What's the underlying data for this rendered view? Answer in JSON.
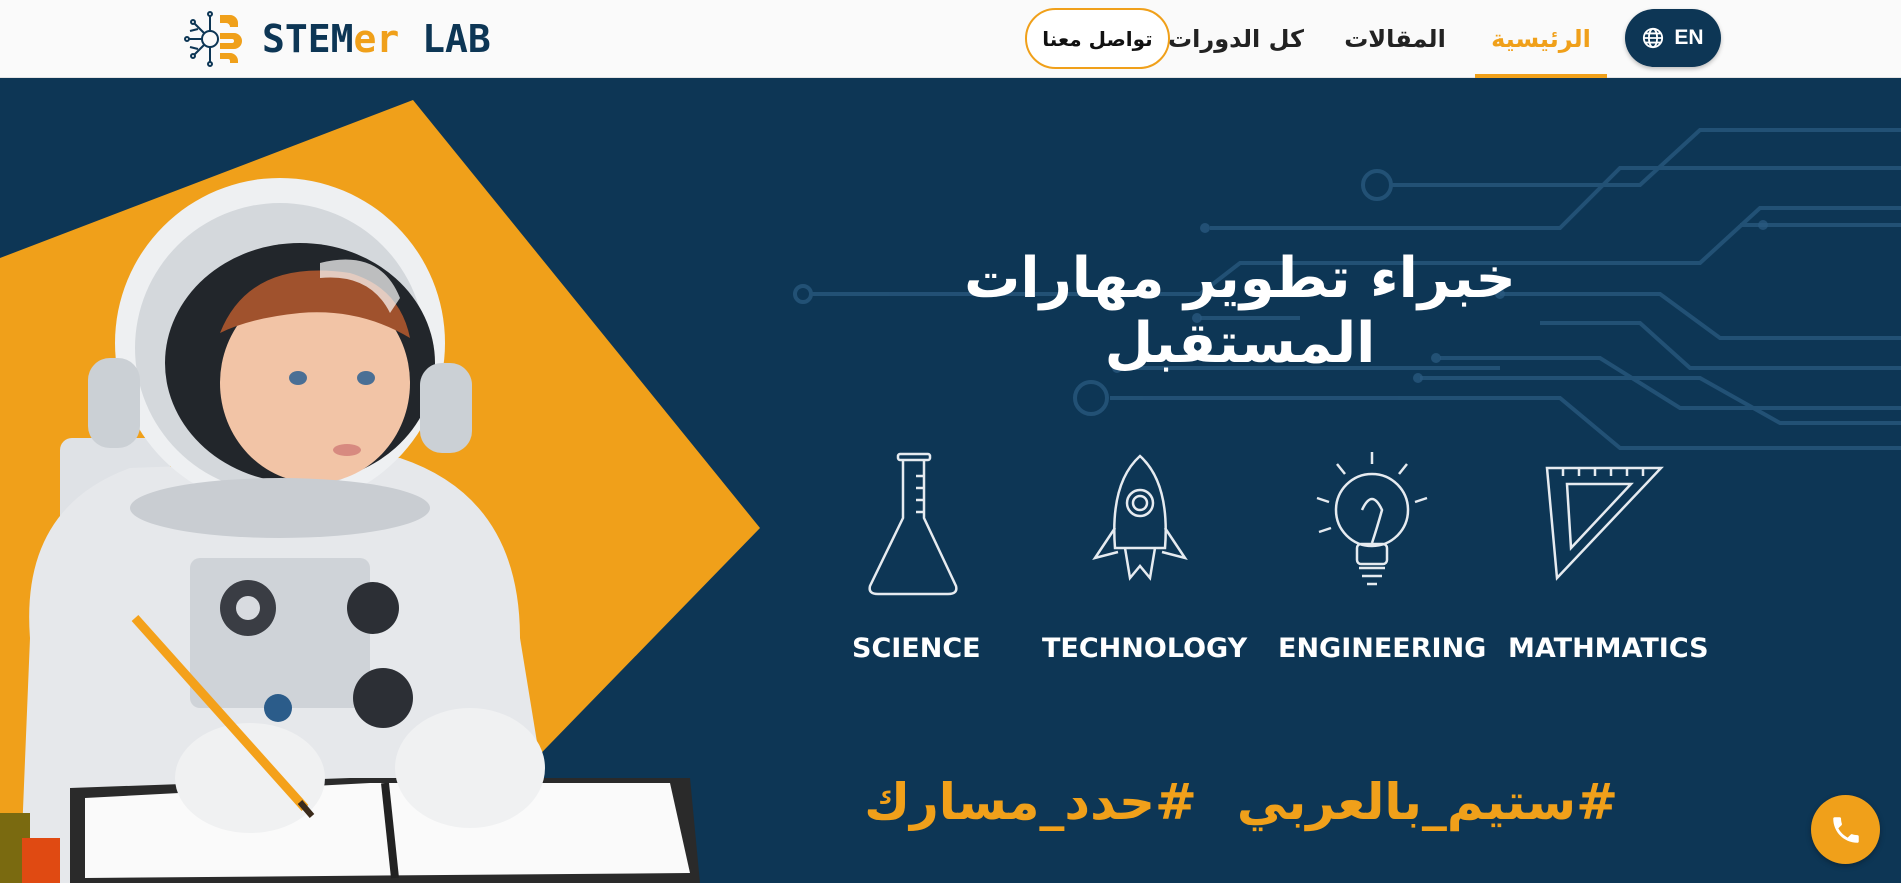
{
  "brand": {
    "logo_text_a": "STEM",
    "logo_text_b": "er",
    "logo_text_c": " LAB",
    "colors": {
      "navy": "#0d3655",
      "accent": "#f0a01a"
    }
  },
  "nav": {
    "lang_label": "EN",
    "lang_icon": "globe-icon",
    "home": "الرئيسية",
    "articles": "المقالات",
    "courses": "كل الدورات",
    "contact": "تواصل معنا",
    "active": "home"
  },
  "hero": {
    "title": "خبراء تطوير مهارات المستقبل",
    "stem": [
      {
        "label": "SCIENCE",
        "icon": "flask-icon"
      },
      {
        "label": "TECHNOLOGY",
        "icon": "rocket-icon"
      },
      {
        "label": "ENGINEERING",
        "icon": "lightbulb-icon"
      },
      {
        "label": "MATHMATICS",
        "icon": "set-square-icon"
      }
    ],
    "hashtags": [
      "#ستيم_بالعربي",
      "#حدد_مسارك"
    ]
  },
  "floating": {
    "phone_icon": "phone-icon"
  }
}
